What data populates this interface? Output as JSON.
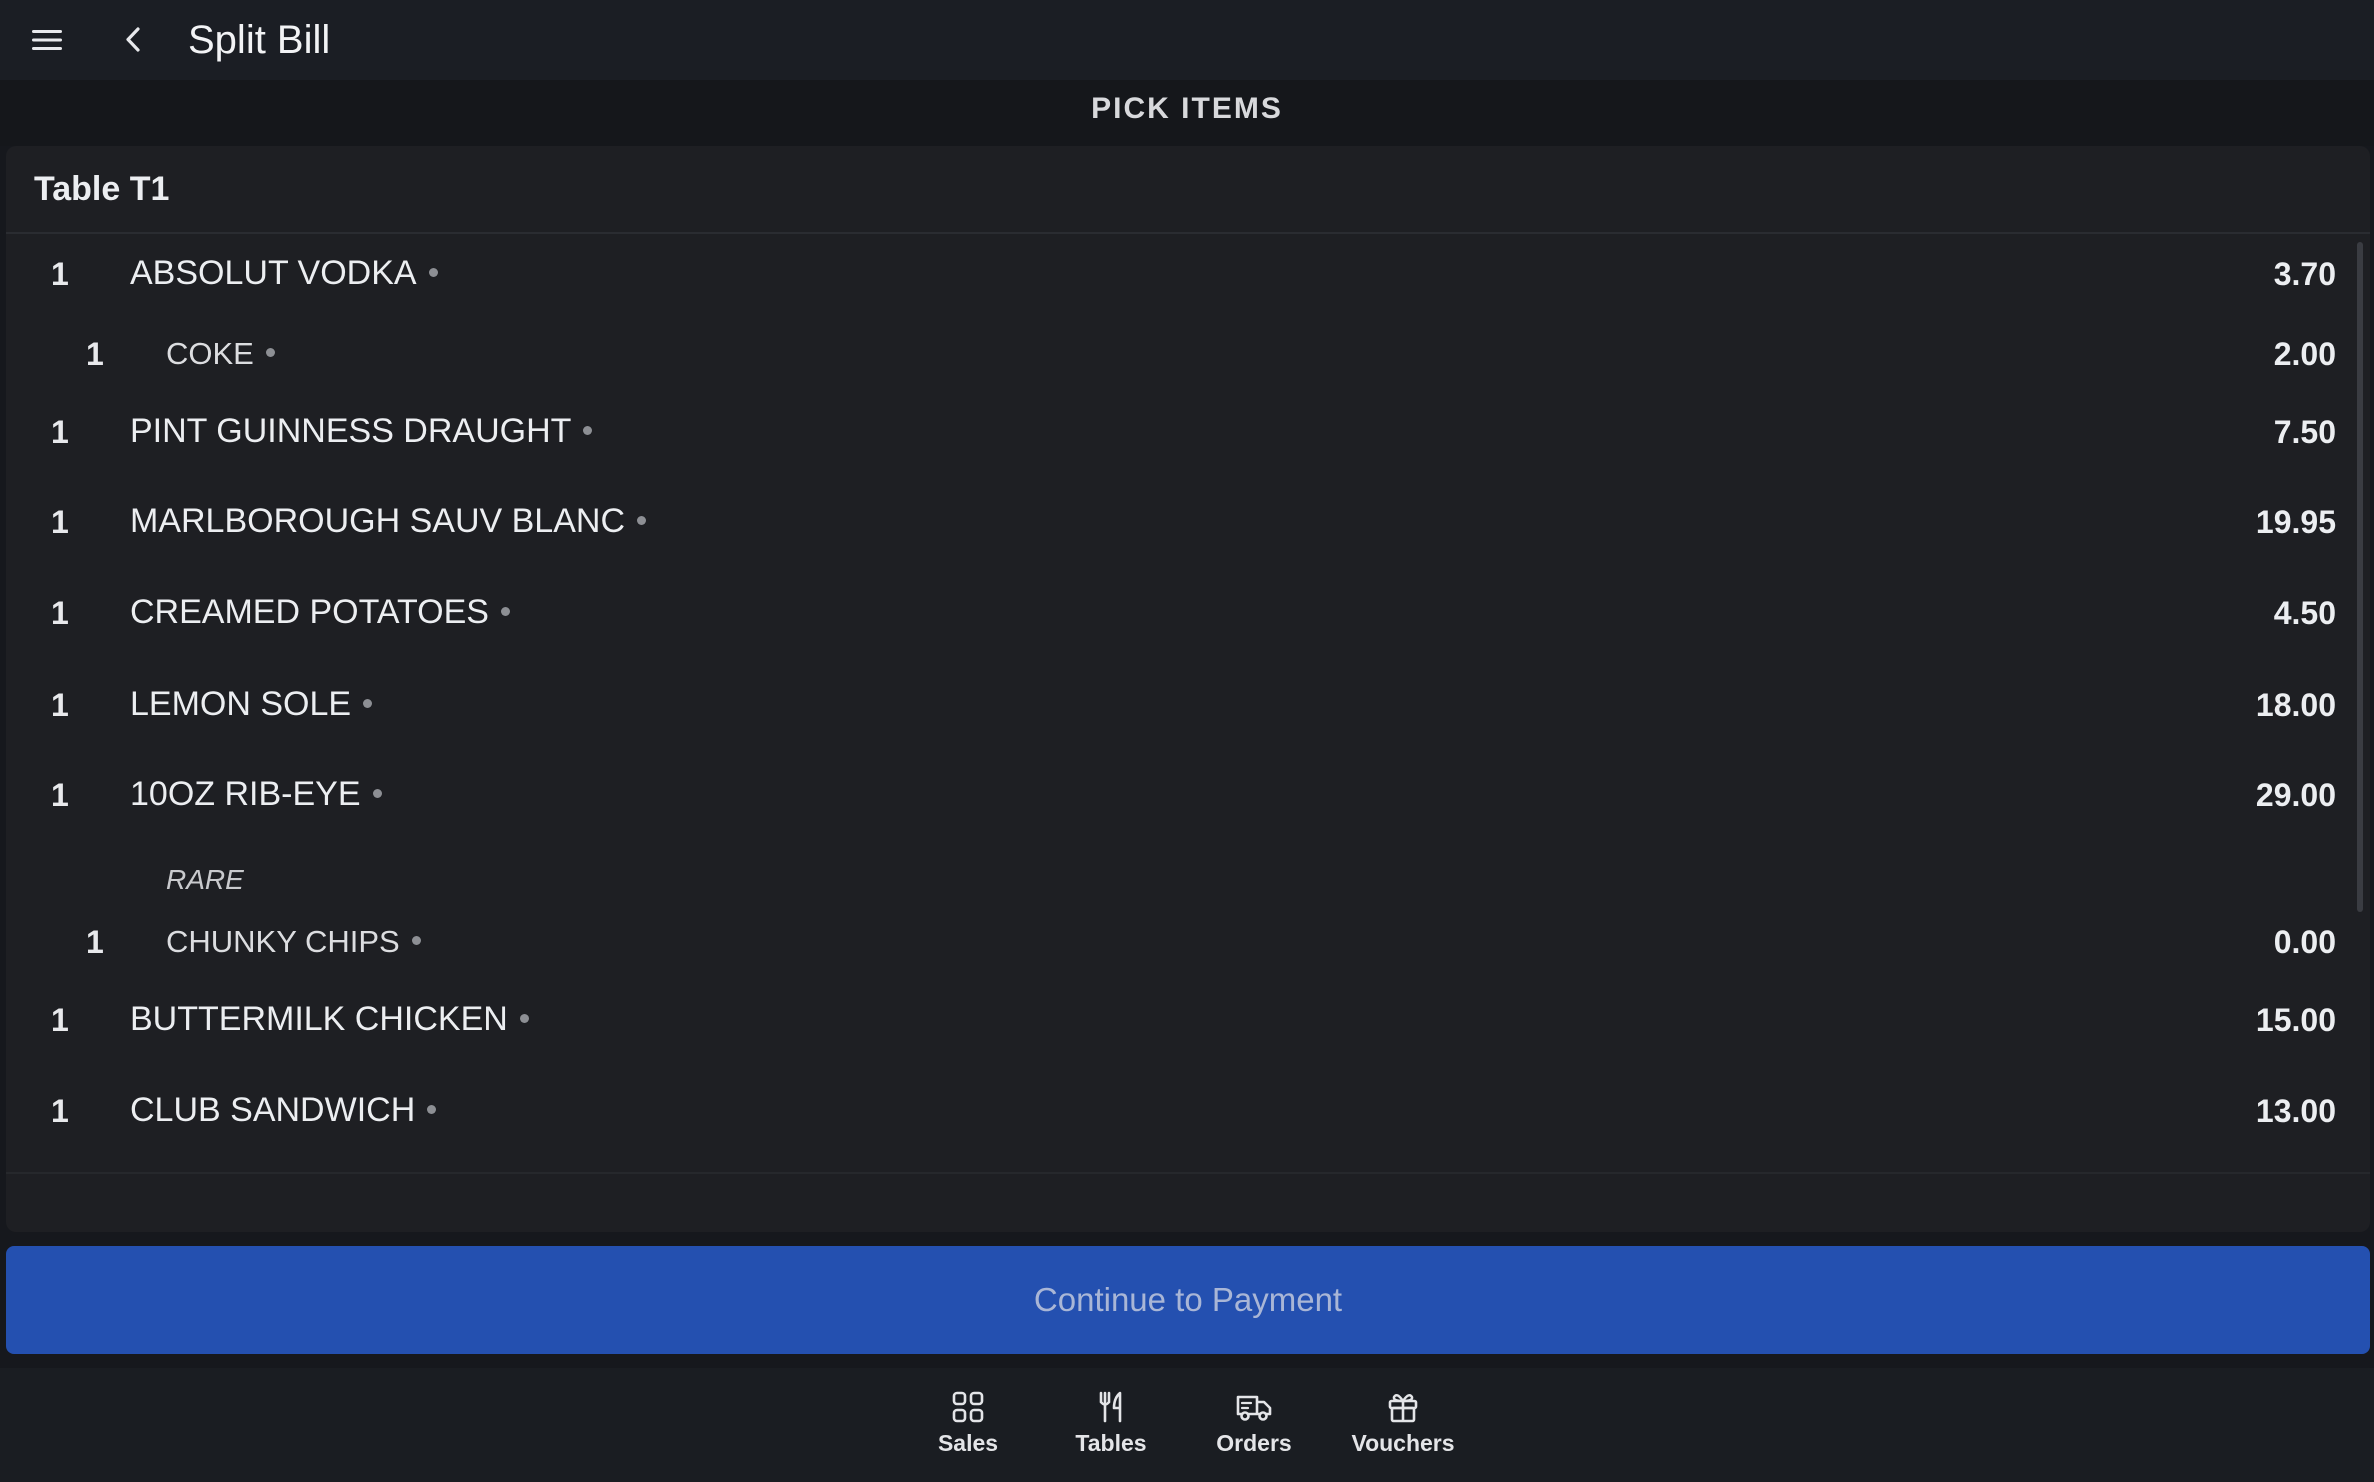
{
  "header": {
    "title": "Split Bill",
    "subheader": "PICK ITEMS"
  },
  "table": {
    "title": "Table T1"
  },
  "items": [
    {
      "qty": "1",
      "name": "ABSOLUT VODKA",
      "price": "3.70"
    },
    {
      "qty": "1",
      "name": "COKE",
      "price": "2.00",
      "sub": true
    },
    {
      "qty": "1",
      "name": "PINT GUINNESS DRAUGHT",
      "price": "7.50"
    },
    {
      "qty": "1",
      "name": "MARLBOROUGH SAUV BLANC",
      "price": "19.95"
    },
    {
      "qty": "1",
      "name": "CREAMED POTATOES",
      "price": "4.50"
    },
    {
      "qty": "1",
      "name": "LEMON SOLE",
      "price": "18.00"
    },
    {
      "qty": "1",
      "name": "10OZ RIB-EYE",
      "price": "29.00"
    },
    {
      "note": "RARE"
    },
    {
      "qty": "1",
      "name": "CHUNKY CHIPS",
      "price": "0.00",
      "sub": true
    },
    {
      "qty": "1",
      "name": "BUTTERMILK CHICKEN",
      "price": "15.00"
    },
    {
      "qty": "1",
      "name": "CLUB SANDWICH",
      "price": "13.00"
    }
  ],
  "actions": {
    "continue_label": "Continue to Payment"
  },
  "nav": {
    "sales": "Sales",
    "tables": "Tables",
    "orders": "Orders",
    "vouchers": "Vouchers"
  },
  "colors": {
    "accent": "#2450b0",
    "background": "#16181d",
    "panel": "#1e1f23"
  },
  "icons": [
    "menu-icon",
    "back-arrow-icon",
    "grid-icon",
    "cutlery-icon",
    "delivery-truck-icon",
    "gift-icon"
  ]
}
